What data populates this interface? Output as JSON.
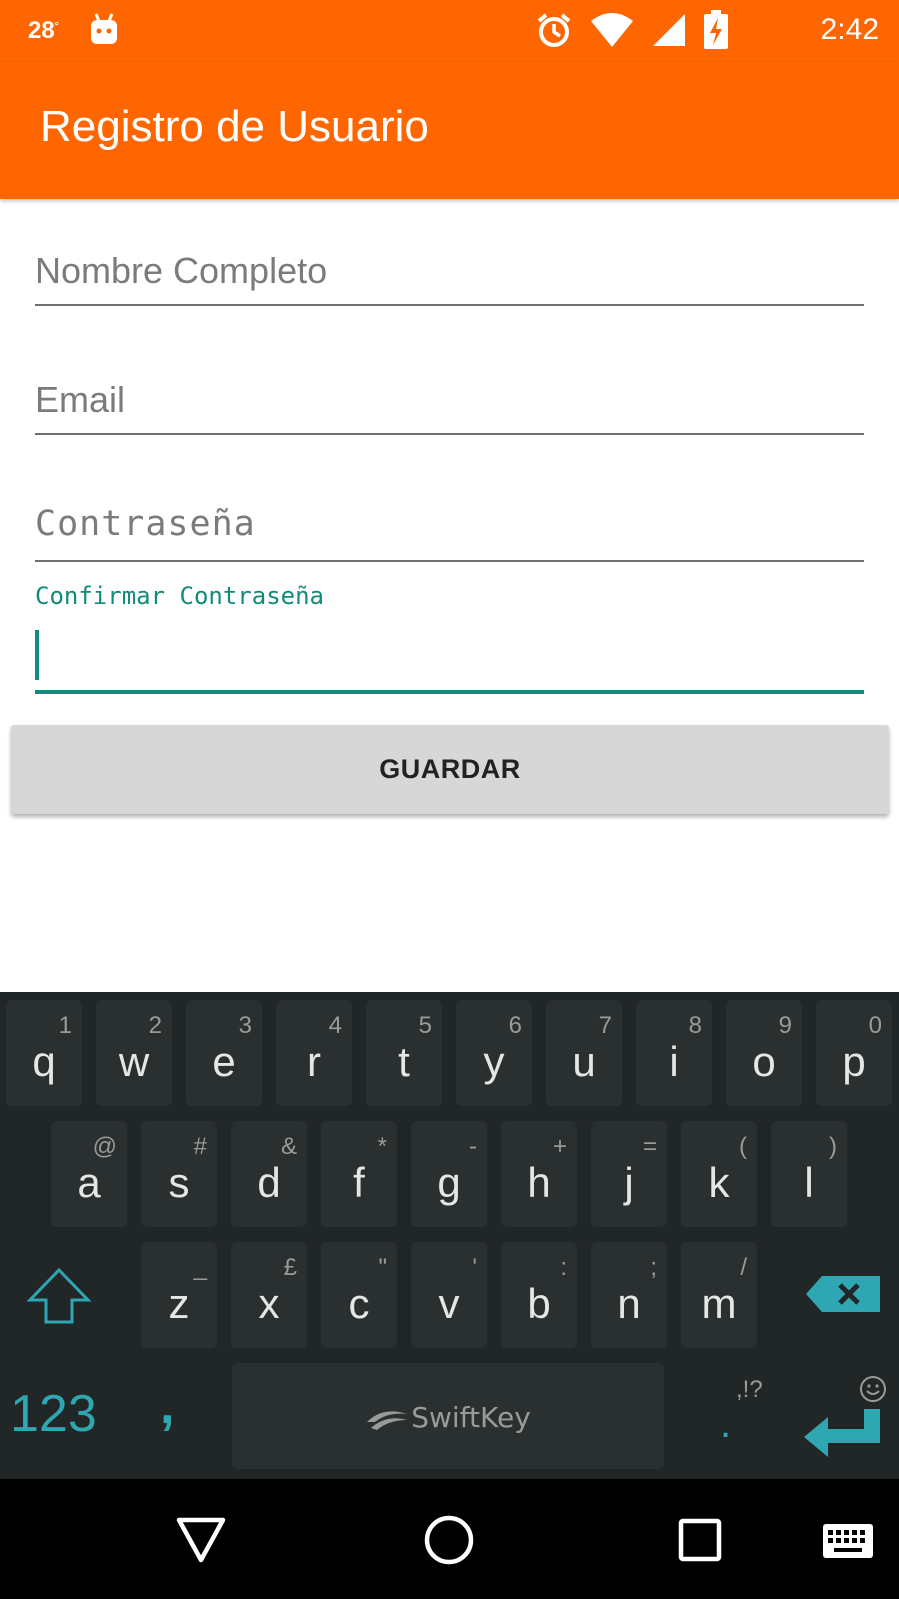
{
  "status_bar": {
    "temperature": "28",
    "degree": "°",
    "time": "2:42"
  },
  "app_bar": {
    "title": "Registro de Usuario"
  },
  "form": {
    "name_placeholder": "Nombre Completo",
    "email_placeholder": "Email",
    "password_placeholder": "Contraseña",
    "confirm_label": "Confirmar Contraseña",
    "confirm_value": "",
    "save_label": "GUARDAR"
  },
  "keyboard": {
    "brand": "SwiftKey",
    "row1": [
      {
        "main": "q",
        "sec": "1"
      },
      {
        "main": "w",
        "sec": "2"
      },
      {
        "main": "e",
        "sec": "3"
      },
      {
        "main": "r",
        "sec": "4"
      },
      {
        "main": "t",
        "sec": "5"
      },
      {
        "main": "y",
        "sec": "6"
      },
      {
        "main": "u",
        "sec": "7"
      },
      {
        "main": "i",
        "sec": "8"
      },
      {
        "main": "o",
        "sec": "9"
      },
      {
        "main": "p",
        "sec": "0"
      }
    ],
    "row2": [
      {
        "main": "a",
        "sec": "@"
      },
      {
        "main": "s",
        "sec": "#"
      },
      {
        "main": "d",
        "sec": "&"
      },
      {
        "main": "f",
        "sec": "*"
      },
      {
        "main": "g",
        "sec": "-"
      },
      {
        "main": "h",
        "sec": "+"
      },
      {
        "main": "j",
        "sec": "="
      },
      {
        "main": "k",
        "sec": "("
      },
      {
        "main": "l",
        "sec": ")"
      }
    ],
    "row3": [
      {
        "main": "z",
        "sec": "_"
      },
      {
        "main": "x",
        "sec": "£"
      },
      {
        "main": "c",
        "sec": "\""
      },
      {
        "main": "v",
        "sec": "'"
      },
      {
        "main": "b",
        "sec": ":"
      },
      {
        "main": "n",
        "sec": ";"
      },
      {
        "main": "m",
        "sec": "/"
      }
    ],
    "numbers_key": "123",
    "comma_key": ",",
    "punct_hint": ",!?",
    "period_key": ".",
    "accent_color": "#2fa7b3"
  }
}
